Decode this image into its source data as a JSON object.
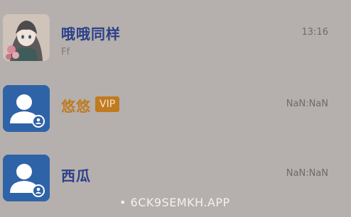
{
  "conversations": [
    {
      "name": "哦哦同样",
      "preview": "Ff",
      "time": "13:16",
      "avatar_type": "anime-girl-avatar"
    },
    {
      "name": "悠悠",
      "badge": "VIP",
      "time": "NaN:NaN",
      "avatar_type": "default-user-avatar"
    },
    {
      "name": "西瓜",
      "time": "NaN:NaN",
      "avatar_type": "default-user-avatar"
    }
  ],
  "watermark": "• 6CK9SEMKH.APP",
  "colors": {
    "background": "#b5b0ad",
    "name_blue": "#2c3f8a",
    "name_gold": "#c17a1e",
    "avatar_blue": "#2f63a8"
  }
}
